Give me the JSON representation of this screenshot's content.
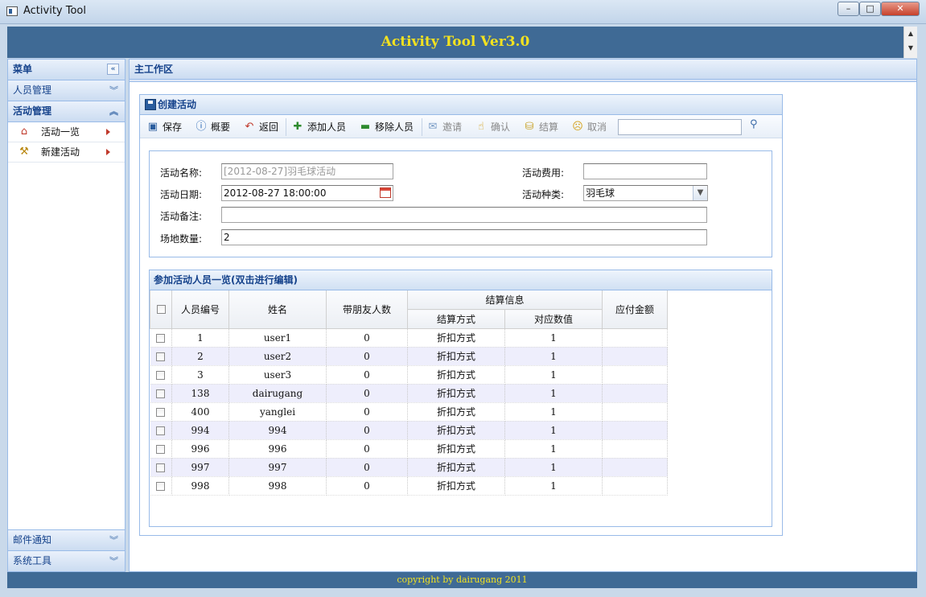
{
  "window": {
    "title": "Activity Tool",
    "min": "–",
    "max": "□",
    "close": "✕"
  },
  "header": {
    "title": "Activity Tool Ver3.0"
  },
  "sidebar": {
    "menu_title": "菜单",
    "sections": {
      "personnel": "人员管理",
      "activity": "活动管理",
      "mail": "邮件通知",
      "tools": "系统工具"
    },
    "items": [
      {
        "label": "活动一览",
        "icon": "house-icon"
      },
      {
        "label": "新建活动",
        "icon": "wand-icon"
      }
    ]
  },
  "main": {
    "title": "主工作区"
  },
  "panel": {
    "title": "创建活动",
    "toolbar": {
      "save": "保存",
      "overview": "概要",
      "back": "返回",
      "add_member": "添加人员",
      "remove_member": "移除人员",
      "invite": "邀请",
      "confirm": "确认",
      "settle": "结算",
      "cancel": "取消",
      "search_value": ""
    },
    "form": {
      "name_label": "活动名称:",
      "name_placeholder": "[2012-08-27]羽毛球活动",
      "fee_label": "活动费用:",
      "fee_value": "",
      "date_label": "活动日期:",
      "date_value": "2012-08-27 18:00:00",
      "type_label": "活动种类:",
      "type_value": "羽毛球",
      "note_label": "活动备注:",
      "note_value": "",
      "venue_label": "场地数量:",
      "venue_value": "2"
    },
    "grid": {
      "title": "参加活动人员一览(双击进行编辑)",
      "columns": {
        "id": "人员编号",
        "name": "姓名",
        "friends": "带朋友人数",
        "settle_group": "结算信息",
        "settle_method": "结算方式",
        "settle_value": "对应数值",
        "amount": "应付金额"
      },
      "rows": [
        {
          "id": "1",
          "name": "user1",
          "friends": "0",
          "method": "折扣方式",
          "value": "1",
          "amount": ""
        },
        {
          "id": "2",
          "name": "user2",
          "friends": "0",
          "method": "折扣方式",
          "value": "1",
          "amount": ""
        },
        {
          "id": "3",
          "name": "user3",
          "friends": "0",
          "method": "折扣方式",
          "value": "1",
          "amount": ""
        },
        {
          "id": "138",
          "name": "dairugang",
          "friends": "0",
          "method": "折扣方式",
          "value": "1",
          "amount": ""
        },
        {
          "id": "400",
          "name": "yanglei",
          "friends": "0",
          "method": "折扣方式",
          "value": "1",
          "amount": ""
        },
        {
          "id": "994",
          "name": "994",
          "friends": "0",
          "method": "折扣方式",
          "value": "1",
          "amount": ""
        },
        {
          "id": "996",
          "name": "996",
          "friends": "0",
          "method": "折扣方式",
          "value": "1",
          "amount": ""
        },
        {
          "id": "997",
          "name": "997",
          "friends": "0",
          "method": "折扣方式",
          "value": "1",
          "amount": ""
        },
        {
          "id": "998",
          "name": "998",
          "friends": "0",
          "method": "折扣方式",
          "value": "1",
          "amount": ""
        }
      ]
    }
  },
  "footer": {
    "text": "copyright by dairugang 2011"
  },
  "colors": {
    "header_bg": "#3f6a95",
    "header_text": "#f3e21f",
    "panel_border": "#99bbe8",
    "title_text": "#15428b"
  }
}
